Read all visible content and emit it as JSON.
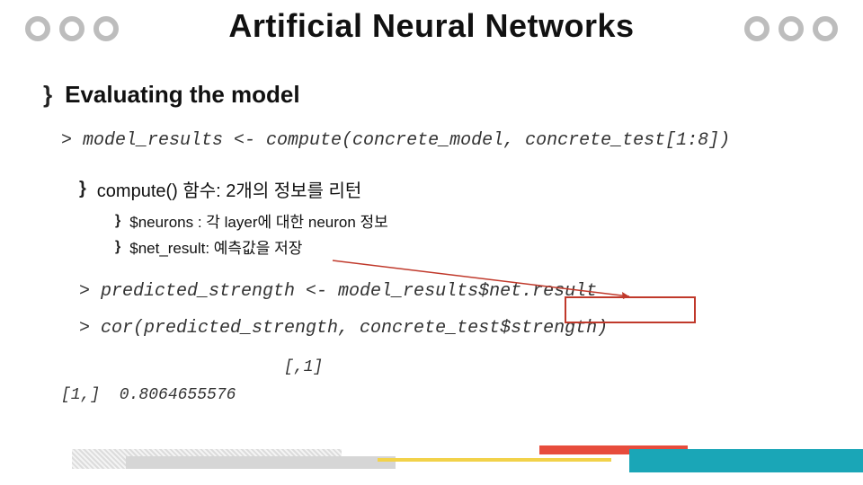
{
  "title": "Artificial Neural Networks",
  "section": {
    "heading": "Evaluating the model",
    "code_compute": "> model_results <- compute(concrete_model, concrete_test[1:8])",
    "sub_heading": "compute() 함수: 2개의 정보를 리턴",
    "bullets": [
      "$neurons : 각 layer에 대한 neuron 정보",
      "$net_result: 예측값을 저장"
    ],
    "code_predicted": "> predicted_strength <- model_results$net.result",
    "code_cor": "> cor(predicted_strength, concrete_test$strength)",
    "result_header": "          [,1]",
    "result_row": "[1,]  0.8064655576"
  }
}
